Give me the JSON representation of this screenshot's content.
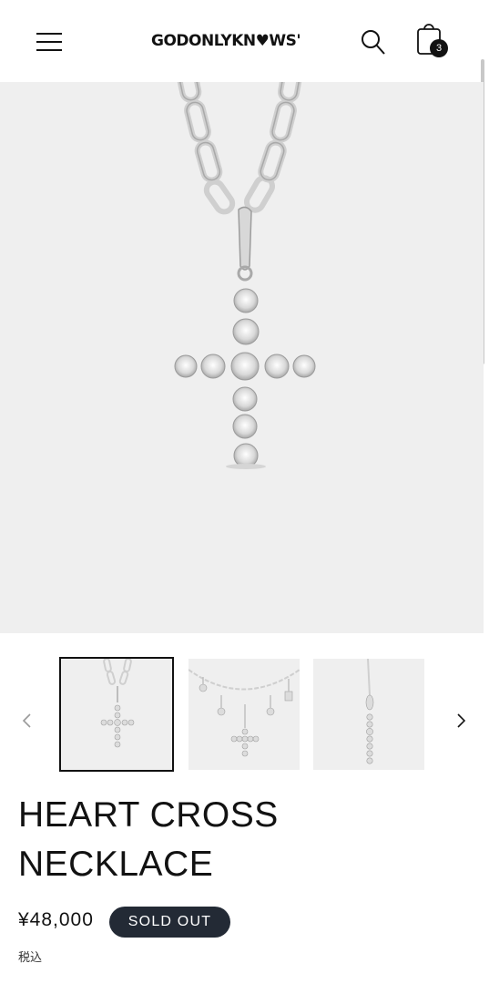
{
  "header": {
    "logo": "GODONLYKN♥WS'",
    "cart_count": "3"
  },
  "product": {
    "title_line1": "HEART CROSS",
    "title_line2": "NECKLACE",
    "price": "¥48,000",
    "status_badge": "SOLD OUT",
    "tax_note": "税込"
  },
  "gallery": {
    "thumbnail_count": 3,
    "active_index": 0
  },
  "colors": {
    "text": "#121212",
    "badge_bg": "#232a35",
    "image_bg": "#efefef"
  }
}
